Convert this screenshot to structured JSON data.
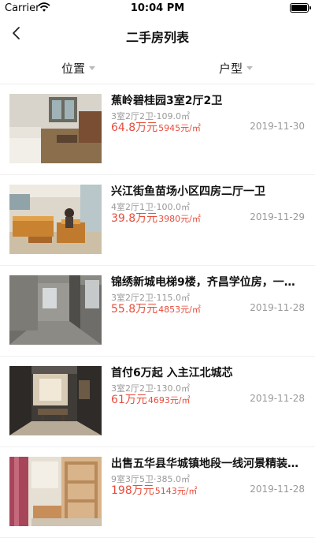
{
  "status_bar": {
    "carrier": "Carrier",
    "time": "10:04 PM"
  },
  "nav": {
    "title": "二手房列表",
    "back_icon": "chevron-left-icon"
  },
  "filters": [
    {
      "label": "位置"
    },
    {
      "label": "户型"
    }
  ],
  "colors": {
    "price": "#e74c3c",
    "secondary_text": "#999999",
    "divider": "#eeeeee"
  },
  "listings": [
    {
      "title": "蕉岭碧桂园3室2厅2卫",
      "specs": "3室2厅2卫·109.0㎡",
      "price": "64.8万元",
      "unit_price": "5945元/㎡",
      "date": "2019-11-30"
    },
    {
      "title": "兴江街鱼苗场小区四房二厅一卫",
      "specs": "4室2厅1卫·100.0㎡",
      "price": "39.8万元",
      "unit_price": "3980元/㎡",
      "date": "2019-11-29"
    },
    {
      "title": "锦绣新城电梯9楼，齐昌学位房，一…",
      "specs": "3室2厅2卫·115.0㎡",
      "price": "55.8万元",
      "unit_price": "4853元/㎡",
      "date": "2019-11-28"
    },
    {
      "title": "首付6万起 入主江北城芯",
      "specs": "3室2厅2卫·130.0㎡",
      "price": "61万元",
      "unit_price": "4693元/㎡",
      "date": "2019-11-28"
    },
    {
      "title": "出售五华县华城镇地段一线河景精装…",
      "specs": "9室3厅5卫·385.0㎡",
      "price": "198万元",
      "unit_price": "5143元/㎡",
      "date": "2019-11-28"
    }
  ]
}
